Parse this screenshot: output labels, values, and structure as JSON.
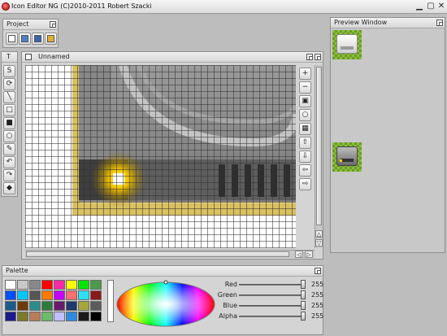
{
  "window": {
    "title": "Icon Editor NG (C)2010-2011 Robert Szacki",
    "controls": [
      "minimize",
      "maximize",
      "close"
    ]
  },
  "project_panel": {
    "title": "Project",
    "buttons": [
      {
        "name": "new-project-icon",
        "label": ""
      },
      {
        "name": "open-project-icon",
        "label": ""
      },
      {
        "name": "save-project-icon",
        "label": ""
      },
      {
        "name": "edit-project-icon",
        "label": ""
      }
    ]
  },
  "tools_panel": {
    "title": "T",
    "tools": [
      {
        "name": "freehand-icon",
        "glyph": "S"
      },
      {
        "name": "spiral-icon",
        "glyph": "⟳"
      },
      {
        "name": "line-icon",
        "glyph": "╲"
      },
      {
        "name": "rectangle-icon",
        "glyph": "□"
      },
      {
        "name": "filled-rectangle-icon",
        "glyph": "■"
      },
      {
        "name": "ellipse-icon",
        "glyph": "○"
      },
      {
        "name": "pipette-icon",
        "glyph": "✎"
      },
      {
        "name": "undo-icon",
        "glyph": "↶"
      },
      {
        "name": "redo-icon",
        "glyph": "↷"
      },
      {
        "name": "fill-icon",
        "glyph": "◆"
      }
    ]
  },
  "canvas_window": {
    "title": "Unnamed",
    "side_tools": [
      {
        "name": "zoom-in-icon",
        "glyph": "+"
      },
      {
        "name": "zoom-out-icon",
        "glyph": "−"
      },
      {
        "name": "show-icon-preview-icon",
        "glyph": "▣"
      },
      {
        "name": "circle-mode-icon",
        "glyph": "○"
      },
      {
        "name": "grid-toggle-icon",
        "glyph": "▦"
      },
      {
        "name": "shift-up-icon",
        "glyph": "⇧"
      },
      {
        "name": "shift-down-icon",
        "glyph": "⇩"
      },
      {
        "name": "shift-left-icon",
        "glyph": "⇦"
      },
      {
        "name": "shift-right-icon",
        "glyph": "⇨"
      }
    ]
  },
  "preview_panel": {
    "title": "Preview Window"
  },
  "palette_panel": {
    "title": "Palette",
    "swatches": [
      "#ffffff",
      "#c8c8c8",
      "#888888",
      "#ff0000",
      "#ff2aa6",
      "#ffff00",
      "#00e600",
      "#4b9b4b",
      "#0050ff",
      "#00c8ff",
      "#555555",
      "#ff7a00",
      "#c800ff",
      "#ff6f6f",
      "#2ce0ff",
      "#8a1a1a",
      "#1b5b8b",
      "#6b3b0b",
      "#2e8b8b",
      "#2e7b3b",
      "#6b1b6b",
      "#1b3b6b",
      "#a6a63b",
      "#5b5b5b",
      "#1b1b8b",
      "#7a7a2a",
      "#b97b5b",
      "#6bbb6b",
      "#bfbfff",
      "#2b8bdf",
      "#1b1b1b",
      "#000000"
    ],
    "sliders": [
      {
        "label": "Red",
        "value": "255",
        "level": 1.0
      },
      {
        "label": "Green",
        "value": "255",
        "level": 1.0
      },
      {
        "label": "Blue",
        "value": "255",
        "level": 1.0
      },
      {
        "label": "Alpha",
        "value": "255",
        "level": 1.0
      }
    ]
  }
}
